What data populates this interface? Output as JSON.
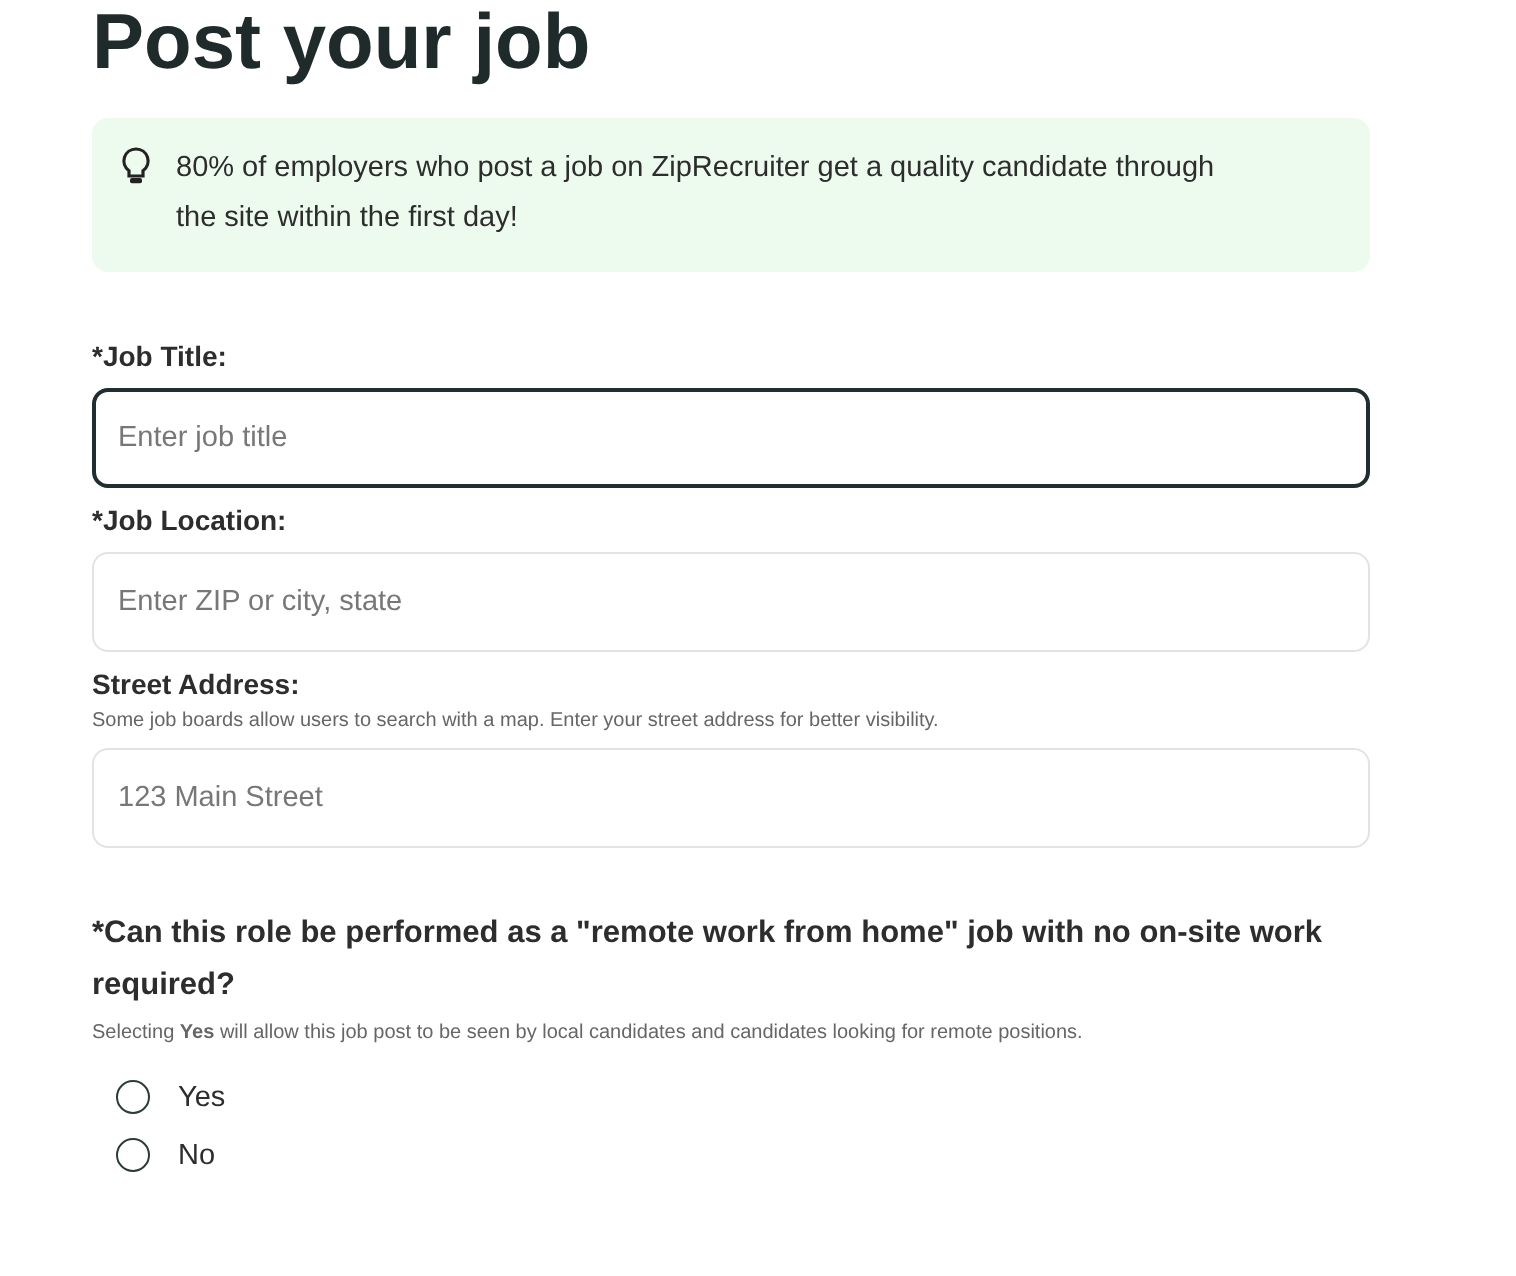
{
  "heading": "Post your job",
  "tip": {
    "text": "80% of employers who post a job on ZipRecruiter get a quality candidate through the site within the first day!"
  },
  "fields": [
    {
      "label": "*Job Title:",
      "placeholder": "Enter job title",
      "focused": true
    },
    {
      "label": "*Job Location:",
      "placeholder": "Enter ZIP or city, state",
      "focused": false
    },
    {
      "label": "Street Address:",
      "hint": "Some job boards allow users to search with a map. Enter your street address for better visibility.",
      "placeholder": "123 Main Street",
      "focused": false
    }
  ],
  "question": {
    "label": "*Can this role be performed as a \"remote work from home\" job with no on-site work required?",
    "hint": "Selecting **Yes** will allow this job post to be seen by local candidates and candidates looking for remote positions.",
    "options": [
      {
        "label": "Yes",
        "selected": false
      },
      {
        "label": "No",
        "selected": false
      }
    ]
  }
}
